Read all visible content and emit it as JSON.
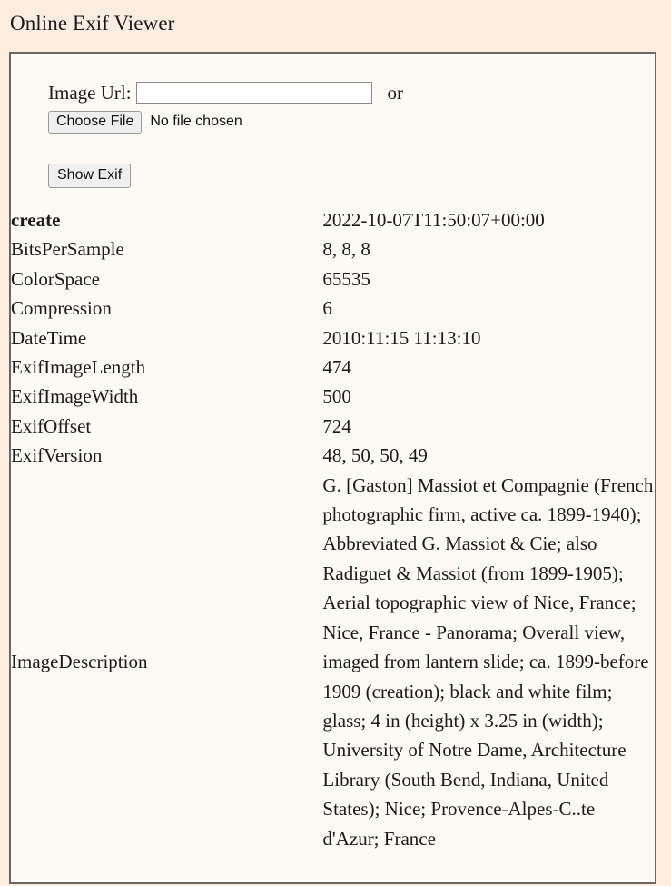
{
  "page": {
    "title": "Online Exif Viewer"
  },
  "form": {
    "url_label": "Image Url:",
    "url_value": "",
    "url_placeholder": "",
    "or_text": "or",
    "choose_file_label": "Choose File",
    "no_file_text": "No file chosen",
    "show_exif_label": "Show Exif"
  },
  "exif": {
    "rows": [
      {
        "key": "create",
        "value": "2022-10-07T11:50:07+00:00",
        "bold": true
      },
      {
        "key": "BitsPerSample",
        "value": "8, 8, 8",
        "bold": false
      },
      {
        "key": "ColorSpace",
        "value": "65535",
        "bold": false
      },
      {
        "key": "Compression",
        "value": "6",
        "bold": false
      },
      {
        "key": "DateTime",
        "value": "2010:11:15 11:13:10",
        "bold": false
      },
      {
        "key": "ExifImageLength",
        "value": "474",
        "bold": false
      },
      {
        "key": "ExifImageWidth",
        "value": "500",
        "bold": false
      },
      {
        "key": "ExifOffset",
        "value": "724",
        "bold": false
      },
      {
        "key": "ExifVersion",
        "value": "48, 50, 50, 49",
        "bold": false
      },
      {
        "key": "ImageDescription",
        "value": "G. [Gaston] Massiot et Compagnie (French photographic firm, active ca. 1899-1940); Abbreviated G. Massiot & Cie; also Radiguet & Massiot (from 1899-1905); Aerial topographic view of Nice, France; Nice, France - Panorama; Overall view, imaged from lantern slide; ca. 1899-before 1909 (creation); black and white film; glass; 4 in (height) x 3.25 in (width); University of Notre Dame, Architecture Library (South Bend, Indiana, United States); Nice; Provence-Alpes-C..te d'Azur; France",
        "bold": false,
        "long": true
      }
    ]
  },
  "colors": {
    "page_background": "#fdece0",
    "panel_background": "#fdfaf5",
    "panel_border": "#6b6864",
    "text": "#1b1b1b"
  }
}
